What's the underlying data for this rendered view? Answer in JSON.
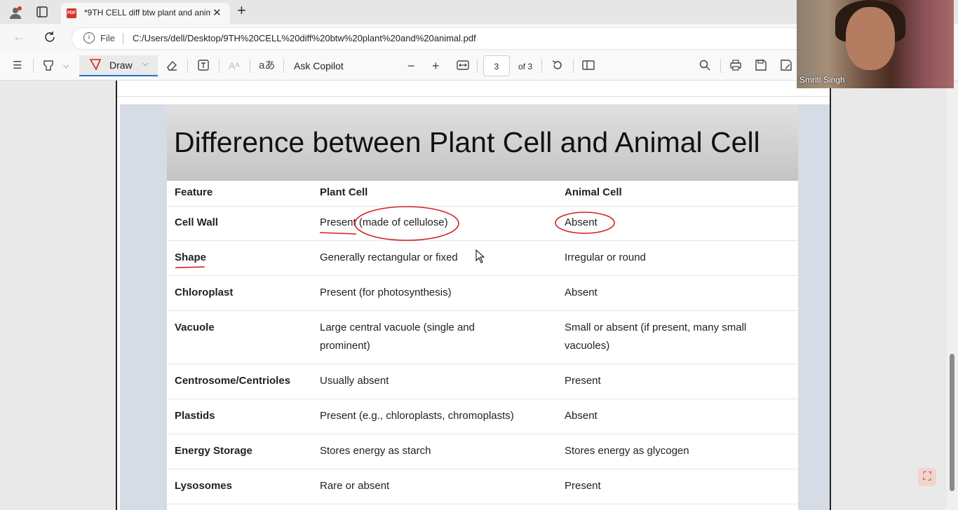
{
  "tab": {
    "title": "*9TH CELL diff btw plant and anim",
    "pdf_badge": "PDF"
  },
  "address": {
    "file_label": "File",
    "url": "C:/Users/dell/Desktop/9TH%20CELL%20diff%20btw%20plant%20and%20animal.pdf"
  },
  "toolbar": {
    "draw_label": "Draw",
    "copilot_label": "Ask Copilot",
    "page_value": "3",
    "page_total": "of 3"
  },
  "slide": {
    "title": "Difference between Plant Cell and Animal Cell",
    "headers": {
      "feature": "Feature",
      "plant": "Plant Cell",
      "animal": "Animal Cell"
    },
    "rows": [
      {
        "feature": "Cell Wall",
        "plant": "Present (made of cellulose)",
        "animal": "Absent"
      },
      {
        "feature": "Shape",
        "plant": "Generally rectangular or fixed",
        "animal": "Irregular or round"
      },
      {
        "feature": "Chloroplast",
        "plant": "Present (for photosynthesis)",
        "animal": "Absent"
      },
      {
        "feature": "Vacuole",
        "plant": "Large central vacuole (single and prominent)",
        "animal": "Small or absent (if present, many small vacuoles)"
      },
      {
        "feature": "Centrosome/Centrioles",
        "plant": "Usually absent",
        "animal": "Present"
      },
      {
        "feature": "Plastids",
        "plant": "Present (e.g., chloroplasts, chromoplasts)",
        "animal": "Absent"
      },
      {
        "feature": "Energy Storage",
        "plant": "Stores energy as starch",
        "animal": "Stores energy as glycogen"
      },
      {
        "feature": "Lysosomes",
        "plant": "Rare or absent",
        "animal": "Present"
      }
    ]
  },
  "webcam": {
    "name": "Smriti Singh"
  },
  "colors": {
    "ink_annotation": "#d42020",
    "accent": "#2b6cd6"
  }
}
